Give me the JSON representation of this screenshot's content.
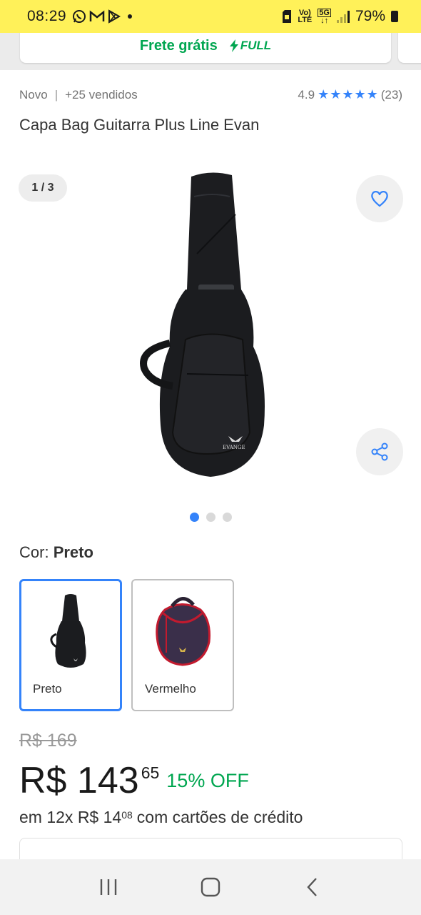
{
  "status_bar": {
    "time": "08:29",
    "battery": "79%",
    "network_top": "Vo)",
    "network_bottom": "LTE",
    "net_5g": "5G",
    "icons": [
      "whatsapp-icon",
      "gmail-icon",
      "play-store-icon",
      "dot-icon",
      "sim-icon",
      "volte-icon",
      "5g-icon",
      "signal-icon",
      "battery-icon"
    ]
  },
  "shipping": {
    "text": "Frete grátis",
    "badge": "FULL"
  },
  "product": {
    "condition": "Novo",
    "sold": "+25 vendidos",
    "rating": "4.9",
    "reviews": "(23)",
    "title": "Capa Bag Guitarra Plus Line Evan"
  },
  "gallery": {
    "counter": "1 / 3",
    "brand_on_image": "EVANGE",
    "dots": 3,
    "active_dot": 0
  },
  "color": {
    "label": "Cor: ",
    "selected": "Preto",
    "options": [
      {
        "name": "Preto",
        "selected": true
      },
      {
        "name": "Vermelho",
        "selected": false
      }
    ]
  },
  "price": {
    "old": "R$ 169",
    "main": "R$ 143",
    "cents": "65",
    "off": "15% OFF",
    "installment_prefix": "em 12x R$ 14",
    "installment_cents": "08",
    "installment_suffix": "com cartões de crédito"
  },
  "colors": {
    "accent_blue": "#3483fa",
    "green": "#00a650",
    "status_yellow": "#fff159"
  }
}
